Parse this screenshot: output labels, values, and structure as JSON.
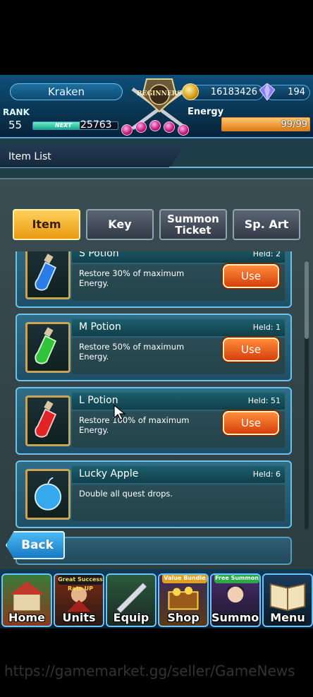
{
  "header": {
    "player_name": "Kraken",
    "rank_label": "RANK",
    "rank_value": "55",
    "next_label": "NEXT",
    "next_value": "25763",
    "emblem_text": "BEGINNERS",
    "coins": "16183426",
    "crystals": "194",
    "energy_label": "Energy",
    "energy_value": "99/99",
    "energy_fraction": 1.0,
    "exp_fraction": 0.55
  },
  "title": "Item List",
  "tabs": [
    {
      "label": "Item",
      "active": true
    },
    {
      "label": "Key",
      "active": false
    },
    {
      "label": "Summon Ticket",
      "active": false
    },
    {
      "label": "Sp. Art",
      "active": false
    }
  ],
  "items": [
    {
      "name": "S Potion",
      "held": "Held: 2",
      "desc": "Restore 30% of maximum Energy.",
      "use_label": "Use",
      "icon": "blue-potion-icon",
      "color": "#2a7de8"
    },
    {
      "name": "M Potion",
      "held": "Held: 1",
      "desc": "Restore 50% of maximum Energy.",
      "use_label": "Use",
      "icon": "green-potion-icon",
      "color": "#2fc43a"
    },
    {
      "name": "L Potion",
      "held": "Held: 51",
      "desc": "Restore 100% of maximum Energy.",
      "use_label": "Use",
      "icon": "red-potion-icon",
      "color": "#e22424"
    },
    {
      "name": "Lucky Apple",
      "held": "Held: 6",
      "desc": "Double all quest drops.",
      "use_label": "",
      "icon": "blue-apple-icon",
      "color": "#35a8ee"
    }
  ],
  "back_label": "Back",
  "nav": [
    {
      "label": "Home",
      "badge": "",
      "icon": "house-icon"
    },
    {
      "label": "Units",
      "badge": "Great Success Rate UP",
      "icon": "warrior-icon"
    },
    {
      "label": "Equip",
      "badge": "",
      "icon": "sword-icon"
    },
    {
      "label": "Shop",
      "badge": "Value Bundle",
      "icon": "treasure-icon"
    },
    {
      "label": "Summon",
      "badge": "Free Summon",
      "icon": "hero-icon"
    },
    {
      "label": "Menu",
      "badge": "",
      "icon": "book-icon"
    }
  ],
  "watermark": "https://gamemarket.gg/seller/GameNews"
}
